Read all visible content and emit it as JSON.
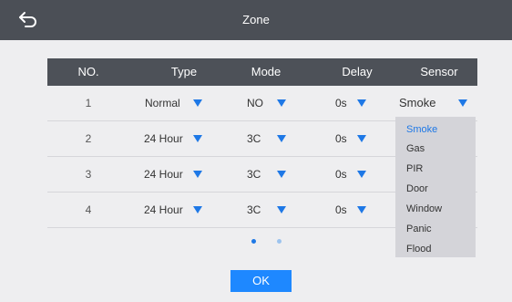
{
  "header": {
    "title": "Zone"
  },
  "table": {
    "columns": [
      "NO.",
      "Type",
      "Mode",
      "Delay",
      "Sensor"
    ],
    "rows": [
      {
        "no": "1",
        "type": "Normal",
        "mode": "NO",
        "delay": "0s",
        "sensor": "Smoke"
      },
      {
        "no": "2",
        "type": "24 Hour",
        "mode": "3C",
        "delay": "0s"
      },
      {
        "no": "3",
        "type": "24 Hour",
        "mode": "3C",
        "delay": "0s"
      },
      {
        "no": "4",
        "type": "24 Hour",
        "mode": "3C",
        "delay": "0s"
      }
    ]
  },
  "sensor_dropdown": {
    "options": [
      "Smoke",
      "Gas",
      "PIR",
      "Door",
      "Window",
      "Panic",
      "Flood"
    ],
    "selected": "Smoke"
  },
  "pagination": {
    "pages": 2,
    "current": 1
  },
  "ok_label": "OK",
  "colors": {
    "accent": "#1e78e6",
    "header_bg": "#4d5158",
    "topbar_bg": "#4b4f56"
  }
}
